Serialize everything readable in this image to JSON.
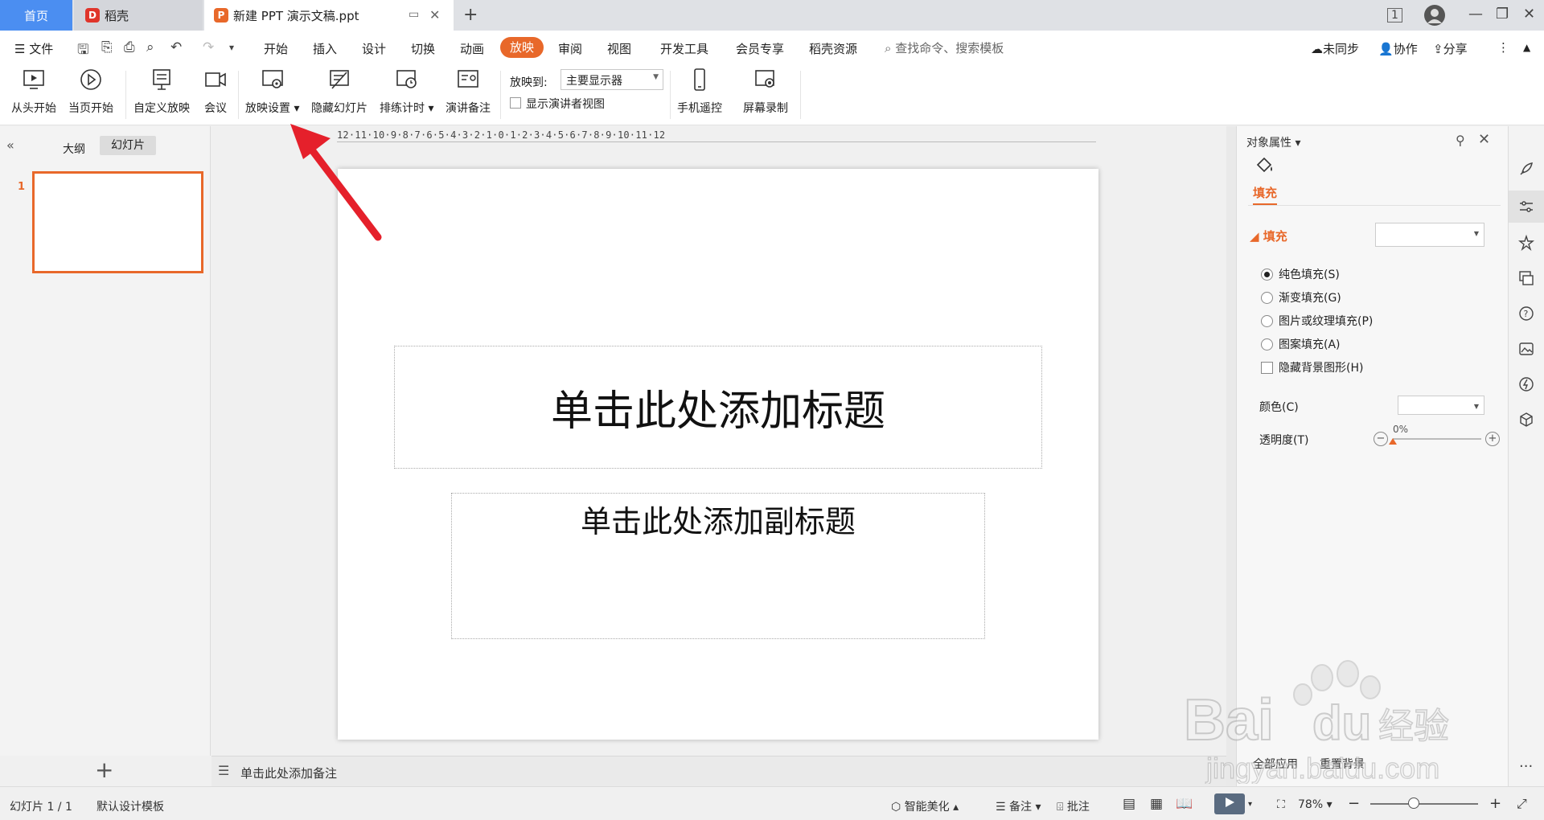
{
  "tabs": {
    "home": "首页",
    "daoke": "稻壳",
    "document": "新建 PPT 演示文稿.ppt"
  },
  "menu": {
    "file": "文件",
    "items": [
      "开始",
      "插入",
      "设计",
      "切换",
      "动画",
      "放映",
      "审阅",
      "视图",
      "开发工具",
      "会员专享",
      "稻壳资源"
    ],
    "search_placeholder": "查找命令、搜索模板",
    "sync": "未同步",
    "collab": "协作",
    "share": "分享"
  },
  "ribbon": {
    "from_start": "从头开始",
    "from_current": "当页开始",
    "custom_show": "自定义放映",
    "meeting": "会议",
    "show_settings": "放映设置",
    "hide_slide": "隐藏幻灯片",
    "rehearse_timing": "排练计时",
    "speaker_notes": "演讲备注",
    "show_to_label": "放映到:",
    "show_to_value": "主要显示器",
    "presenter_view": "显示演讲者视图",
    "phone_remote": "手机遥控",
    "screen_record": "屏幕录制"
  },
  "left_panel": {
    "outline_tab": "大纲",
    "slides_tab": "幻灯片",
    "slide_number": "1"
  },
  "ruler_text": "12·11·10·9·8·7·6·5·4·3·2·1·0·1·2·3·4·5·6·7·8·9·10·11·12",
  "slide": {
    "title_placeholder": "单击此处添加标题",
    "subtitle_placeholder": "单击此处添加副标题"
  },
  "notes": {
    "placeholder": "单击此处添加备注"
  },
  "properties": {
    "title": "对象属性",
    "fill_tab": "填充",
    "fill_section": "填充",
    "options": [
      {
        "label": "纯色填充(S)",
        "selected": true
      },
      {
        "label": "渐变填充(G)",
        "selected": false
      },
      {
        "label": "图片或纹理填充(P)",
        "selected": false
      },
      {
        "label": "图案填充(A)",
        "selected": false
      }
    ],
    "hide_bg_graphics": "隐藏背景图形(H)",
    "color_label": "颜色(C)",
    "transparency_label": "透明度(T)",
    "transparency_value": "0%",
    "transparency_fraction": 0,
    "apply_all": "全部应用",
    "reset_bg": "重置背景"
  },
  "status": {
    "slide_count": "幻灯片 1 / 1",
    "template": "默认设计模板",
    "smart_beautify": "智能美化",
    "notes": "备注",
    "comments": "批注",
    "zoom": "78%",
    "zoom_fraction": 0.4
  },
  "watermark": {
    "brand": "Bai",
    "brand2": "du",
    "product": "经验",
    "url": "jingyan.baidu.com"
  },
  "colors": {
    "accent": "#e8682a",
    "home_tab": "#4b8ef1",
    "arrow": "#e5202b"
  }
}
